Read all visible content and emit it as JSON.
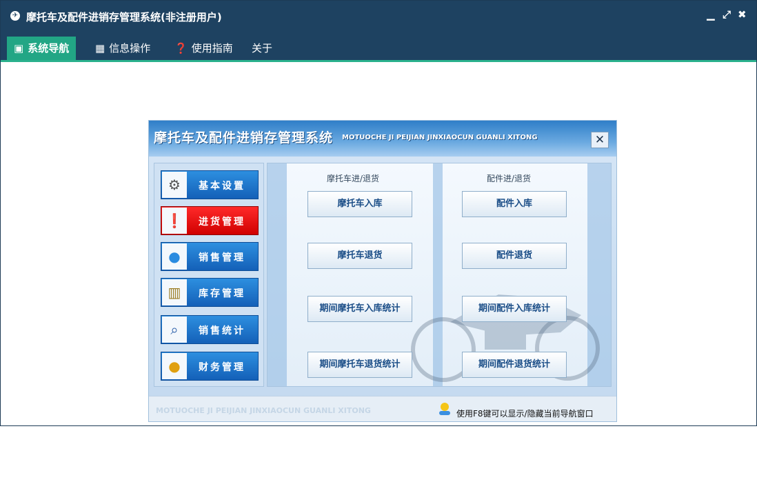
{
  "window": {
    "title": "摩托车及配件进销存管理系统(非注册用户)",
    "controls": [
      "minimize-icon",
      "restore-icon",
      "close-icon"
    ]
  },
  "menu": {
    "tabs": [
      {
        "label": "系统导航",
        "icon": "monitor-icon",
        "active": true
      },
      {
        "label": "信息操作",
        "icon": "grid-icon"
      },
      {
        "label": "使用指南",
        "icon": "help-icon"
      },
      {
        "label": "关于"
      }
    ]
  },
  "nav": {
    "title": "摩托车及配件进销存管理系统",
    "pinyin": "MOTUOCHE JI PEIJIAN JINXIAOCUN GUANLI XITONG",
    "sidebar": [
      {
        "label": "基本设置",
        "icon": "gear-icon"
      },
      {
        "label": "进货管理",
        "icon": "alert-monitor-icon",
        "active": true
      },
      {
        "label": "销售管理",
        "icon": "users-icon"
      },
      {
        "label": "库存管理",
        "icon": "warehouse-icon"
      },
      {
        "label": "销售统计",
        "icon": "magnifier-icon"
      },
      {
        "label": "财务管理",
        "icon": "coins-icon"
      }
    ],
    "col1": {
      "header": "摩托车进/退货",
      "buttons": [
        "摩托车入库",
        "摩托车退货",
        "期间摩托车入库统计",
        "期间摩托车退货统计"
      ]
    },
    "col2": {
      "header": "配件进/退货",
      "buttons": [
        "配件入库",
        "配件退货",
        "期间配件入库统计",
        "期间配件退货统计"
      ]
    },
    "footer": {
      "pinyin": "MOTUOCHE JI PEIJIAN JINXIAOCUN GUANLI XITONG",
      "hint": "使用F8键可以显示/隐藏当前导航窗口"
    }
  },
  "colors": {
    "titlebar": "#1e4261",
    "tab_active": "#22a685",
    "sidebar_button": "#1a74d0",
    "sidebar_active": "#e60000"
  }
}
